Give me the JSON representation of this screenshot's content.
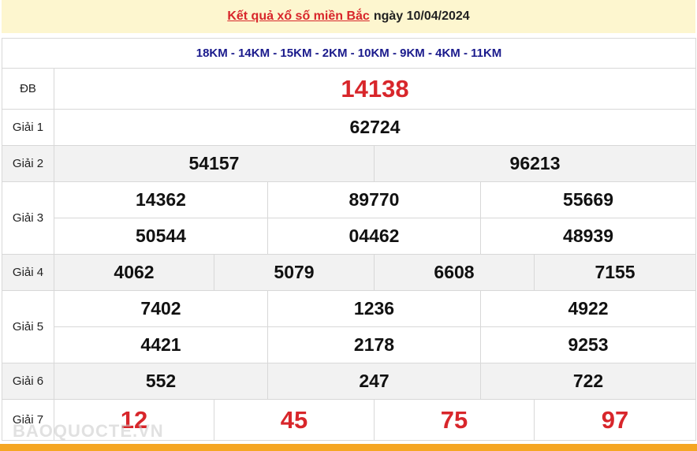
{
  "header": {
    "link_text": "Kết quả xổ số miền Bắc",
    "date_text": "ngày 10/04/2024"
  },
  "codes": "18KM - 14KM - 15KM - 2KM - 10KM - 9KM - 4KM - 11KM",
  "prizes": {
    "db": {
      "label": "ĐB",
      "values": [
        "14138"
      ]
    },
    "g1": {
      "label": "Giải 1",
      "values": [
        "62724"
      ]
    },
    "g2": {
      "label": "Giải 2",
      "values": [
        "54157",
        "96213"
      ]
    },
    "g3": {
      "label": "Giải 3",
      "values": [
        "14362",
        "89770",
        "55669",
        "50544",
        "04462",
        "48939"
      ]
    },
    "g4": {
      "label": "Giải 4",
      "values": [
        "4062",
        "5079",
        "6608",
        "7155"
      ]
    },
    "g5": {
      "label": "Giải 5",
      "values": [
        "7402",
        "1236",
        "4922",
        "4421",
        "2178",
        "9253"
      ]
    },
    "g6": {
      "label": "Giải 6",
      "values": [
        "552",
        "247",
        "722"
      ]
    },
    "g7": {
      "label": "Giải 7",
      "values": [
        "12",
        "45",
        "75",
        "97"
      ]
    }
  },
  "watermark": "BAOQUOCTE.VN",
  "colors": {
    "accent_red": "#d8262b",
    "header_bg": "#fdf6cf",
    "code_blue": "#1a1a8c",
    "bar_orange": "#f5a623"
  }
}
